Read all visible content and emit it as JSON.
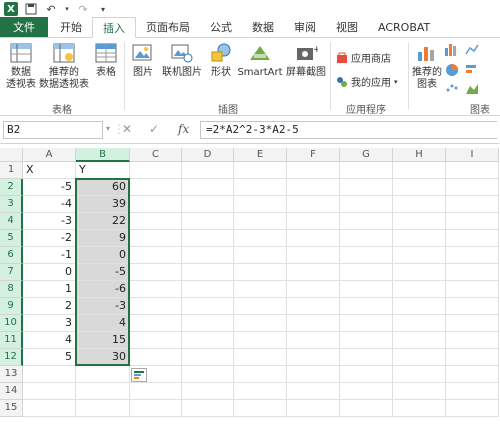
{
  "qat": {
    "app_icon": "X"
  },
  "tabs": [
    {
      "label": "文件"
    },
    {
      "label": "开始"
    },
    {
      "label": "插入"
    },
    {
      "label": "页面布局"
    },
    {
      "label": "公式"
    },
    {
      "label": "数据"
    },
    {
      "label": "审阅"
    },
    {
      "label": "视图"
    },
    {
      "label": "ACROBAT"
    }
  ],
  "ribbon": {
    "pivot_table": "数据\n透视表",
    "pivot_table_l1": "数据",
    "pivot_table_l2": "透视表",
    "rec_pivot_l1": "推荐的",
    "rec_pivot_l2": "数据透视表",
    "table": "表格",
    "group_tables": "表格",
    "picture": "图片",
    "online_picture": "联机图片",
    "shapes": "形状",
    "smartart": "SmartArt",
    "screenshot": "屏幕截图",
    "group_illustrations": "插图",
    "app_store": "应用商店",
    "my_apps": "我的应用",
    "group_apps": "应用程序",
    "rec_charts_l1": "推荐的",
    "rec_charts_l2": "图表",
    "group_charts": "图表"
  },
  "formula_bar": {
    "name_box": "B2",
    "cancel": "✕",
    "enter": "✓",
    "fx": "fx",
    "formula": "=2*A2^2-3*A2-5"
  },
  "columns": [
    "A",
    "B",
    "C",
    "D",
    "E",
    "F",
    "G",
    "H",
    "I"
  ],
  "rows": [
    "1",
    "2",
    "3",
    "4",
    "5",
    "6",
    "7",
    "8",
    "9",
    "10",
    "11",
    "12",
    "13",
    "14",
    "15"
  ],
  "cells": {
    "A1": "X",
    "B1": "Y",
    "A": [
      "-5",
      "-4",
      "-3",
      "-2",
      "-1",
      "0",
      "1",
      "2",
      "3",
      "4",
      "5"
    ],
    "B": [
      "60",
      "39",
      "22",
      "9",
      "0",
      "-5",
      "-6",
      "-3",
      "4",
      "15",
      "30"
    ]
  },
  "colors": {
    "accent": "#217346",
    "selection_fill": "#d9d9d9"
  }
}
